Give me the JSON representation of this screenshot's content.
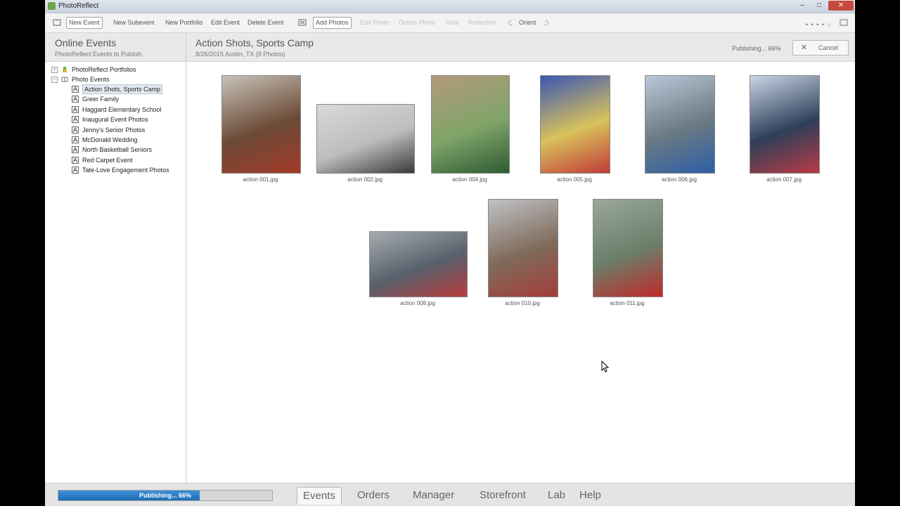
{
  "window": {
    "title": "PhotoReflect",
    "controls": {
      "min": "–",
      "max": "□",
      "close": "✕"
    }
  },
  "toolbar": {
    "items": [
      {
        "label": "New Event",
        "boxed": true,
        "enabled": true
      },
      {
        "label": "New Subevent",
        "enabled": true
      },
      {
        "label": "New Portfolio",
        "enabled": true
      },
      {
        "label": "Edit Event",
        "enabled": true
      },
      {
        "label": "Delete Event",
        "enabled": true
      },
      {
        "label": "Add Photos",
        "boxed": true,
        "enabled": true
      },
      {
        "label": "Edit Photo",
        "enabled": false
      },
      {
        "label": "Delete Photo",
        "enabled": false
      },
      {
        "label": "Hide",
        "enabled": false
      },
      {
        "label": "Reflection",
        "enabled": false
      },
      {
        "label": "Orient",
        "enabled": true
      }
    ],
    "view_dots": "• • • • ○"
  },
  "left_pane": {
    "header_title": "Online Events",
    "header_subtitle": "PhotoReflect Events to Publish",
    "tree": {
      "portfolios": "PhotoReflect Portfolios",
      "photo_events": "Photo Events",
      "events": [
        "Action Shots, Sports Camp",
        "Greer Family",
        "Haggard Elementary School",
        "Inaugural Event Photos",
        "Jenny's Senior Photos",
        "McDonald Wedding",
        "North Basketball Seniors",
        "Red Carpet Event",
        "Tate-Love Engagement Photos"
      ],
      "selected_index": 0
    }
  },
  "right_pane": {
    "event_title": "Action Shots, Sports Camp",
    "event_subtitle": "8/26/2015 Austin, TX (9 Photos)",
    "publishing_text": "Publishing... 66%",
    "cancel_label": "Cancel",
    "photos": [
      {
        "filename": "action 001.jpg",
        "colors": [
          "#6b4a36",
          "#c8c3b9",
          "#a43a2a"
        ]
      },
      {
        "filename": "action 002.jpg",
        "colors": [
          "#bdbdbd",
          "#d9d9d9",
          "#3a3a3a"
        ]
      },
      {
        "filename": "action 004.jpg",
        "colors": [
          "#7fa46a",
          "#b39a78",
          "#2f5b32"
        ]
      },
      {
        "filename": "action 005.jpg",
        "colors": [
          "#d9c25a",
          "#3a56b5",
          "#c03a3a"
        ]
      },
      {
        "filename": "action 006.jpg",
        "colors": [
          "#6a7a82",
          "#b8c8d8",
          "#2d5fa8"
        ]
      },
      {
        "filename": "action 007.jpg",
        "colors": [
          "#2f3f5a",
          "#c8d6e6",
          "#b83a44"
        ]
      },
      {
        "filename": "action 008.jpg",
        "colors": [
          "#57606b",
          "#a6acb0",
          "#b83c3c"
        ]
      },
      {
        "filename": "action 010.jpg",
        "colors": [
          "#7f6a5a",
          "#bfc2c6",
          "#a53d3a"
        ]
      },
      {
        "filename": "action 011.jpg",
        "colors": [
          "#6a7f6a",
          "#9aa89a",
          "#c02a2a"
        ]
      }
    ]
  },
  "statusbar": {
    "progress_label": "Publishing... 66%",
    "progress": 0.66,
    "tabs": [
      "Events",
      "Orders",
      "Manager",
      "Storefront",
      "Lab",
      "Help"
    ],
    "active_tab": 0
  }
}
